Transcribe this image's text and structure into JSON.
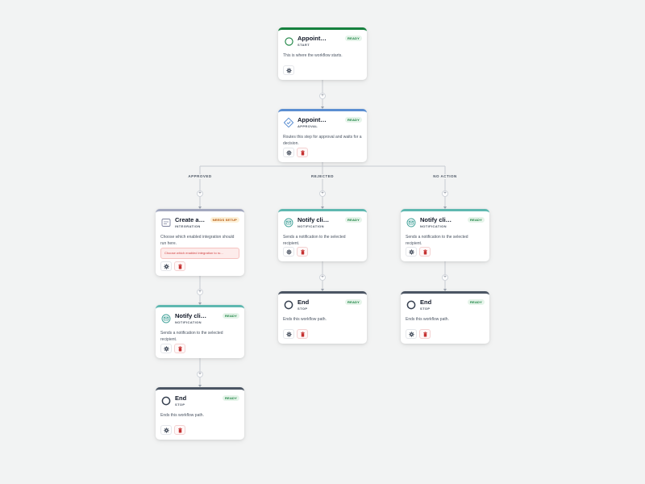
{
  "colors": {
    "canvas_bg": "#f2f3f3",
    "start": "#15803d",
    "approval": "#5b8ed1",
    "integration": "#a3a8bf",
    "notification": "#5fb8b0",
    "stop": "#4b5563",
    "ready_badge": "#15803d",
    "needs_setup_badge": "#b45309",
    "danger": "#d14343"
  },
  "nodes": [
    {
      "id": "start",
      "kind": "start",
      "icon": "circle-icon",
      "title": "Appointment req...",
      "type_label": "START",
      "badge": "READY",
      "badge_kind": "ready",
      "description": "This is where the workflow starts.",
      "actions": [
        "settings"
      ]
    },
    {
      "id": "approval",
      "kind": "approval",
      "icon": "approval-icon",
      "title": "Appointment ap...",
      "type_label": "APPROVAL",
      "badge": "READY",
      "badge_kind": "ready",
      "description": "Routes this step for approval and waits for a decision.",
      "actions": [
        "settings",
        "delete"
      ]
    },
    {
      "id": "integration",
      "kind": "integration",
      "icon": "integration-icon",
      "title": "Create appo...",
      "type_label": "INTEGRATION",
      "badge": "NEEDS SETUP",
      "badge_kind": "setup",
      "description": "Choose which enabled integration should run here.",
      "warning": "Choose which enabled integration to ru...",
      "actions": [
        "settings",
        "delete"
      ]
    },
    {
      "id": "notify-approved",
      "kind": "notification",
      "icon": "notification-icon",
      "title": "Notify client that...",
      "type_label": "NOTIFICATION",
      "badge": "READY",
      "badge_kind": "ready",
      "description": "Sends a notification to the selected recipient.",
      "actions": [
        "settings",
        "delete"
      ]
    },
    {
      "id": "end-approved",
      "kind": "stop",
      "icon": "stop-icon",
      "title": "End",
      "type_label": "STOP",
      "badge": "READY",
      "badge_kind": "ready",
      "description": "Ends this workflow path.",
      "actions": [
        "settings",
        "delete"
      ]
    },
    {
      "id": "notify-rejected",
      "kind": "notification",
      "icon": "notification-icon",
      "title": "Notify client that...",
      "type_label": "NOTIFICATION",
      "badge": "READY",
      "badge_kind": "ready",
      "description": "Sends a notification to the selected recipient.",
      "actions": [
        "settings",
        "delete"
      ]
    },
    {
      "id": "end-rejected",
      "kind": "stop",
      "icon": "stop-icon",
      "title": "End",
      "type_label": "STOP",
      "badge": "READY",
      "badge_kind": "ready",
      "description": "Ends this workflow path.",
      "actions": [
        "settings",
        "delete"
      ]
    },
    {
      "id": "notify-noaction",
      "kind": "notification",
      "icon": "notification-icon",
      "title": "Notify client that...",
      "type_label": "NOTIFICATION",
      "badge": "READY",
      "badge_kind": "ready",
      "description": "Sends a notification to the selected recipient.",
      "actions": [
        "settings",
        "delete"
      ]
    },
    {
      "id": "end-noaction",
      "kind": "stop",
      "icon": "stop-icon",
      "title": "End",
      "type_label": "STOP",
      "badge": "READY",
      "badge_kind": "ready",
      "description": "Ends this workflow path.",
      "actions": [
        "settings",
        "delete"
      ]
    }
  ],
  "branches": [
    {
      "id": "approved",
      "label": "APPROVED"
    },
    {
      "id": "rejected",
      "label": "REJECTED"
    },
    {
      "id": "noaction",
      "label": "NO ACTION"
    }
  ],
  "add_step_label": "+"
}
